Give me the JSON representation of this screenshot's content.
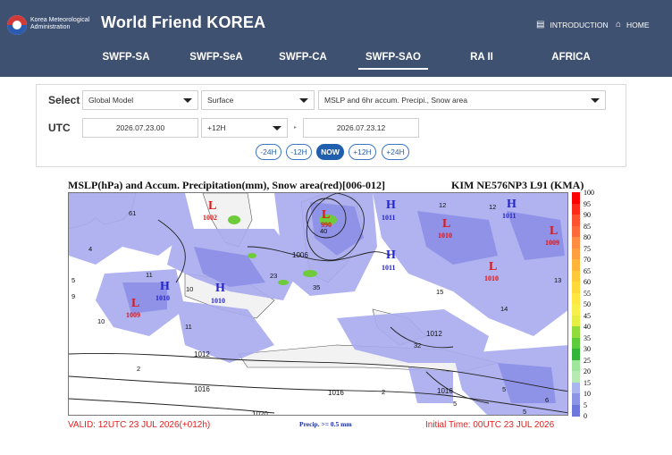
{
  "header": {
    "org_name": "Korea Meteorological Administration",
    "site_title": "World Friend KOREA",
    "links": [
      {
        "label": "INTRODUCTION",
        "icon": "document-icon"
      },
      {
        "label": "HOME",
        "icon": "home-icon"
      }
    ],
    "tabs": [
      {
        "label": "SWFP-SA",
        "active": false
      },
      {
        "label": "SWFP-SeA",
        "active": false
      },
      {
        "label": "SWFP-CA",
        "active": false
      },
      {
        "label": "SWFP-SAO",
        "active": true
      },
      {
        "label": "RA II",
        "active": false
      },
      {
        "label": "AFRICA",
        "active": false
      }
    ]
  },
  "controls": {
    "select_label": "Select",
    "model": "Global Model",
    "level": "Surface",
    "product": "MSLP and 6hr accum. Precipi., Snow area",
    "utc_label": "UTC",
    "base_time": "2026.07.23.00",
    "offset": "+12H",
    "arrow_glyph": "▸",
    "valid_time": "2026.07.23.12",
    "steps": [
      {
        "label": "-24H",
        "active": false
      },
      {
        "label": "-12H",
        "active": false
      },
      {
        "label": "NOW",
        "active": true
      },
      {
        "label": "+12H",
        "active": false
      },
      {
        "label": "+24H",
        "active": false
      }
    ]
  },
  "map": {
    "title": "MSLP(hPa) and Accum. Precipitation(mm), Snow area(red)[006-012]",
    "model": "KIM NE576NP3 L91 (KMA)",
    "valid": "VALID: 12UTC 23 JUL 2026(+012h)",
    "precip_note": "Precip. >= 0.5 mm",
    "initial": "Initial Time: 00UTC 23 JUL 2026",
    "highs": [
      {
        "letter": "H",
        "value": "1011"
      },
      {
        "letter": "H",
        "value": "1011"
      },
      {
        "letter": "H",
        "value": "1010"
      },
      {
        "letter": "H",
        "value": "1010"
      },
      {
        "letter": "H",
        "value": "1011"
      }
    ],
    "lows": [
      {
        "letter": "L",
        "value": "1002"
      },
      {
        "letter": "L",
        "value": "990"
      },
      {
        "letter": "L",
        "value": "1010"
      },
      {
        "letter": "L",
        "value": "1010"
      },
      {
        "letter": "L",
        "value": "1009"
      },
      {
        "letter": "L",
        "value": "1009"
      }
    ],
    "isobar_labels": [
      "1006",
      "1012",
      "1012",
      "1016",
      "1016",
      "1016",
      "1020"
    ],
    "precip_labels": [
      "61",
      "4",
      "5",
      "11",
      "10",
      "9",
      "10",
      "11",
      "40",
      "23",
      "35",
      "12",
      "12",
      "15",
      "14",
      "13",
      "32",
      "2",
      "2",
      "5",
      "5",
      "6",
      "5"
    ],
    "colors": {
      "precip_light": "#a5a8ee",
      "precip_mid": "#8a8de6",
      "green": "#6ecb3a",
      "isobar": "#222222",
      "high": "#2626c8",
      "low": "#e01515"
    }
  },
  "colorbar": {
    "labels": [
      "100",
      "95",
      "90",
      "85",
      "80",
      "75",
      "70",
      "65",
      "60",
      "55",
      "50",
      "45",
      "40",
      "35",
      "30",
      "25",
      "20",
      "15",
      "10",
      "5",
      "0"
    ],
    "colors": [
      "#ff0000",
      "#ff2a1a",
      "#ff5030",
      "#ff6a3a",
      "#ff8c40",
      "#ffa040",
      "#ffb63a",
      "#ffc93a",
      "#ffd83a",
      "#ffe640",
      "#f8f04a",
      "#e6ee42",
      "#8fdc3a",
      "#5ccc3a",
      "#34b53a",
      "#9ee69a",
      "#b6eab0",
      "#aab4ee",
      "#8c94e6",
      "#6e78dc",
      "#ffffff"
    ]
  }
}
